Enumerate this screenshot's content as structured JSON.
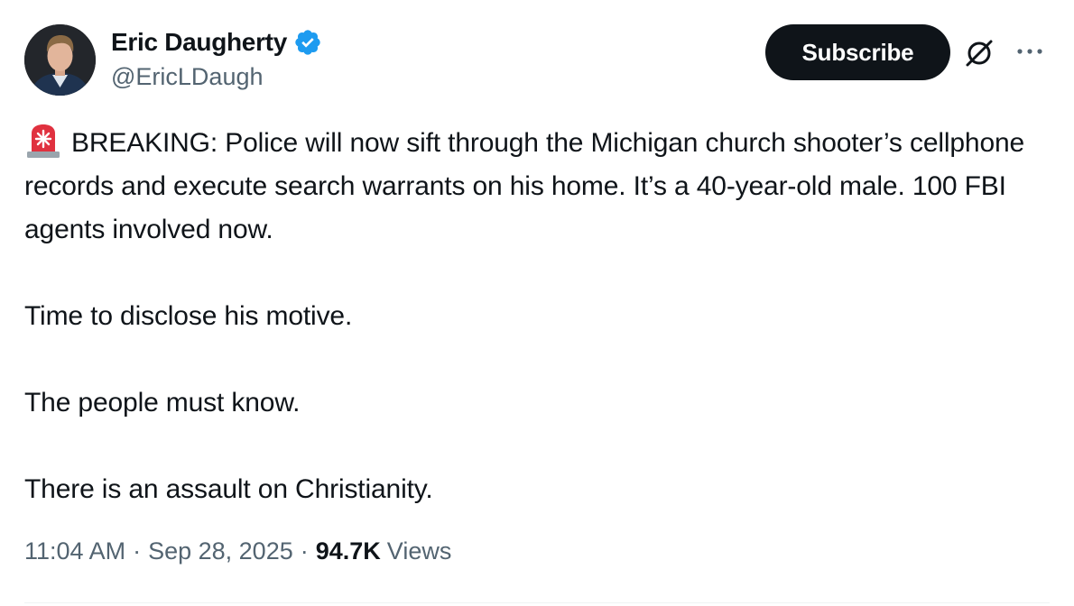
{
  "author": {
    "display_name": "Eric Daugherty",
    "handle": "@EricLDaugh",
    "verified": true,
    "avatar_icon": "profile-photo"
  },
  "header": {
    "subscribe_label": "Subscribe",
    "grok_icon": "grok-icon",
    "more_icon": "more-horizontal-icon"
  },
  "tweet": {
    "emoji_icon": "police-siren-icon",
    "paragraphs": [
      "BREAKING: Police will now sift through the Michigan church shooter’s cellphone records and execute search warrants on his home. It’s a 40-year-old male. 100 FBI agents involved now.",
      "Time to disclose his motive.",
      "The people must know.",
      "There is an assault on Christianity."
    ]
  },
  "meta": {
    "time": "11:04 AM",
    "separator": "·",
    "date": "Sep 28, 2025",
    "views_count": "94.7K",
    "views_label": "Views"
  },
  "colors": {
    "text": "#0f1419",
    "secondary": "#536471",
    "verified": "#1d9bf0",
    "button": "#0f1419"
  }
}
